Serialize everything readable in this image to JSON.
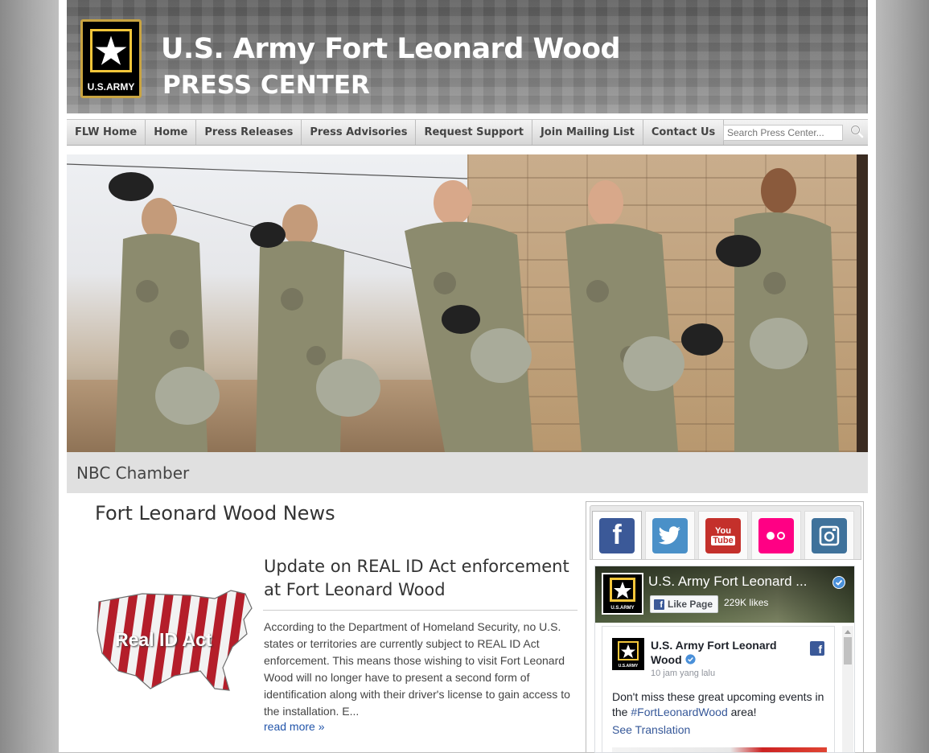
{
  "header": {
    "logo_text": "U.S.ARMY",
    "title_line1": "U.S. Army Fort Leonard Wood",
    "title_line2": "PRESS CENTER"
  },
  "nav": {
    "items": [
      {
        "label": "FLW Home"
      },
      {
        "label": "Home"
      },
      {
        "label": "Press Releases"
      },
      {
        "label": "Press Advisories"
      },
      {
        "label": "Request Support"
      },
      {
        "label": "Join Mailing List"
      },
      {
        "label": "Contact Us"
      }
    ],
    "search_placeholder": "Search Press Center..."
  },
  "hero": {
    "caption": "NBC Chamber"
  },
  "news": {
    "heading": "Fort Leonard Wood News",
    "article": {
      "image_text": "Real ID Act",
      "title": "Update on REAL ID Act enforcement at Fort Leonard Wood",
      "body": "According to the Department of Homeland Security, no U.S. states or territories are currently subject to REAL ID Act enforcement. This means those wishing to visit Fort Leonard Wood will no longer have to present a second form of identification along with their driver's license to gain access to the installation. E...",
      "read_more": "read more »"
    }
  },
  "social": {
    "tabs": [
      {
        "name": "facebook",
        "glyph": "f",
        "color": "#3b5998"
      },
      {
        "name": "twitter",
        "glyph": "t",
        "color": "#4a90c8"
      },
      {
        "name": "youtube",
        "glyph": "You Tube",
        "color": "#c4302b"
      },
      {
        "name": "flickr",
        "glyph": "●○",
        "color": "#ff0084"
      },
      {
        "name": "instagram",
        "glyph": "◘",
        "color": "#3f729b"
      }
    ],
    "facebook": {
      "page_name": "U.S. Army Fort Leonard ...",
      "like_button": "Like Page",
      "likes": "229K likes",
      "post": {
        "page_name": "U.S. Army Fort Leonard Wood",
        "time": "10 jam yang lalu",
        "text_before": "Don't miss these great upcoming events in the ",
        "hashtag": "#FortLeonardWood",
        "text_after": " area!",
        "translate": "See Translation"
      }
    }
  }
}
